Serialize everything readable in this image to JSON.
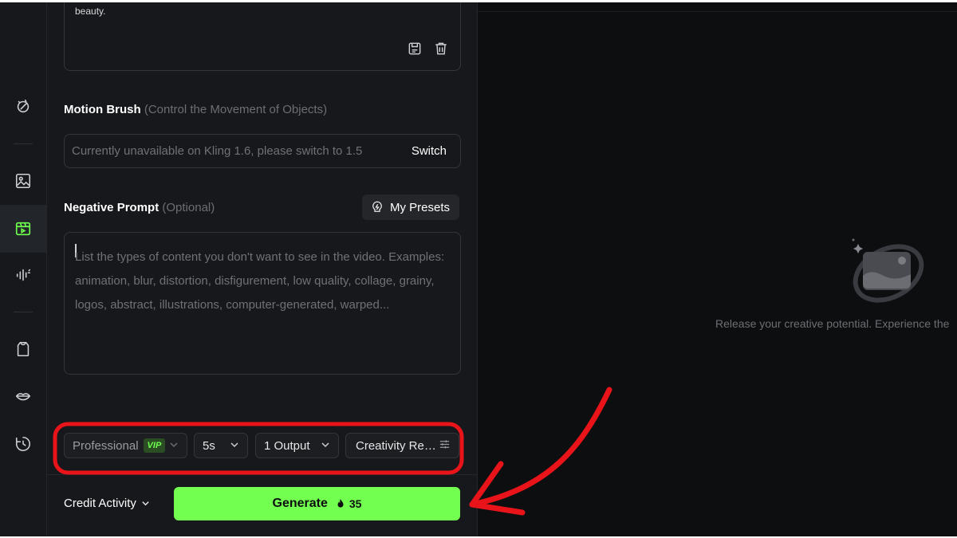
{
  "prompt_box": {
    "text_fragment": "beauty."
  },
  "motion_brush": {
    "title": "Motion Brush",
    "hint": "(Control the Movement of Objects)",
    "message": "Currently unavailable on Kling 1.6, please switch to 1.5",
    "switch_label": "Switch"
  },
  "negative_prompt": {
    "title": "Negative Prompt",
    "hint": "(Optional)",
    "presets_label": "My Presets",
    "placeholder_lines": [
      "List the types of content you don't want to see in the video. Examples:",
      "animation, blur, distortion, disfigurement, low quality, collage, grainy,",
      "logos, abstract, illustrations, computer-generated, warped..."
    ]
  },
  "options": {
    "mode": "Professional",
    "mode_badge": "VIP",
    "duration": "5s",
    "outputs": "1 Output",
    "creativity": "Creativity Re…"
  },
  "footer": {
    "credit_label": "Credit Activity",
    "generate_label": "Generate",
    "cost": "35"
  },
  "canvas": {
    "empty_text": "Release your creative potential. Experience the"
  },
  "colors": {
    "generate_bg": "#72ff4f",
    "accent_green": "#6fff4f",
    "annotation_red": "#e8141a"
  },
  "icons": [
    "ai-effects-icon",
    "image-icon",
    "video-icon",
    "audio-icon",
    "outfit-icon",
    "lip-sync-icon",
    "history-icon",
    "save-icon",
    "trash-icon",
    "presets-icon",
    "chevron-down-icon",
    "sliders-icon",
    "flame-icon"
  ]
}
